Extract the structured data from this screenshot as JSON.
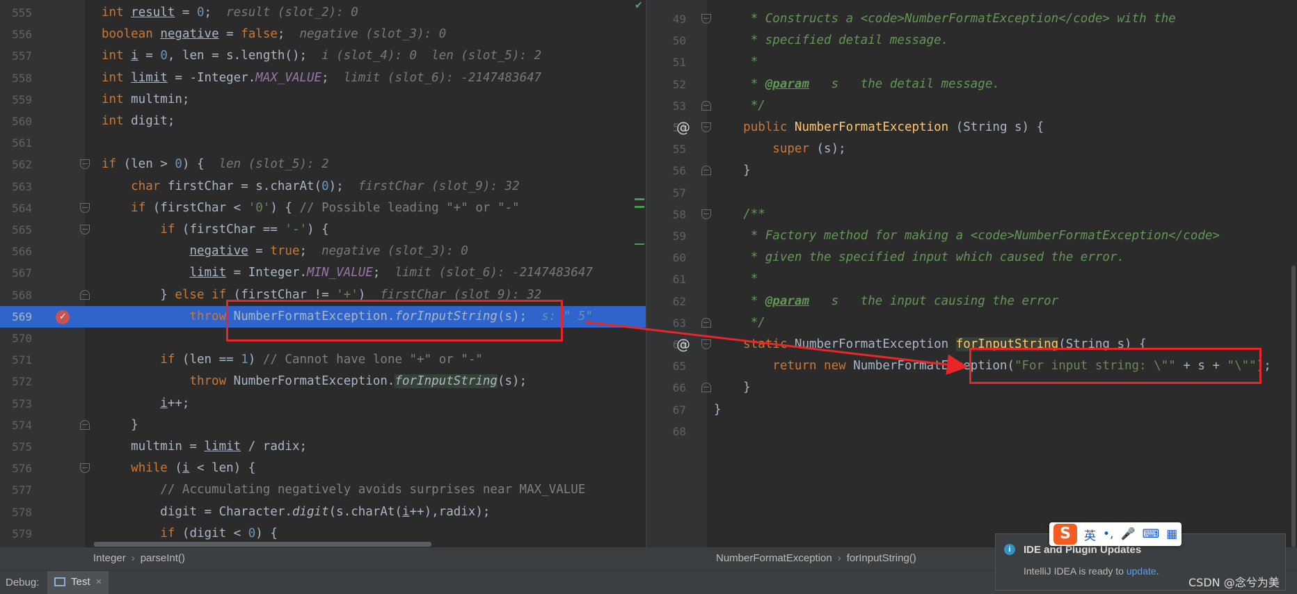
{
  "left_editor": {
    "lines": [
      {
        "n": "555",
        "html": "<span class=\"kw\">int</span> <span class=\"und\">result</span> = <span class=\"num\">0</span>;  <span class=\"hint\">result (slot_2): 0</span>"
      },
      {
        "n": "556",
        "html": "<span class=\"kw\">boolean</span> <span class=\"und\">negative</span> = <span class=\"kw\">false</span>;  <span class=\"hint\">negative (slot_3): 0</span>"
      },
      {
        "n": "557",
        "html": "<span class=\"kw\">int</span> <span class=\"und\">i</span> = <span class=\"num\">0</span>, len = s.length();  <span class=\"hint\">i (slot_4): 0  len (slot_5): 2</span>"
      },
      {
        "n": "558",
        "html": "<span class=\"kw\">int</span> <span class=\"und\">limit</span> = -Integer.<span class=\"italic-c\">MAX_VALUE</span>;  <span class=\"hint\">limit (slot_6): -2147483647</span>"
      },
      {
        "n": "559",
        "html": "<span class=\"kw\">int</span> multmin;"
      },
      {
        "n": "560",
        "html": "<span class=\"kw\">int</span> digit;"
      },
      {
        "n": "561",
        "html": ""
      },
      {
        "n": "562",
        "html": "<span class=\"kw\">if</span> (len &gt; <span class=\"num\">0</span>) {  <span class=\"hint\">len (slot_5): 2</span>"
      },
      {
        "n": "563",
        "html": "    <span class=\"kw\">char</span> firstChar = s.charAt(<span class=\"num\">0</span>);  <span class=\"hint\">firstChar (slot_9): 32</span>"
      },
      {
        "n": "564",
        "html": "    <span class=\"kw\">if</span> (firstChar &lt; <span class=\"str\">'0'</span>) { <span class=\"cm\">// Possible leading \"+\" or \"-\"</span>"
      },
      {
        "n": "565",
        "html": "        <span class=\"kw\">if</span> (firstChar == <span class=\"str\">'-'</span>) {"
      },
      {
        "n": "566",
        "html": "            <span class=\"und\">negative</span> = <span class=\"kw\">true</span>;  <span class=\"hint\">negative (slot_3): 0</span>"
      },
      {
        "n": "567",
        "html": "            <span class=\"und\">limit</span> = Integer.<span class=\"italic-c\">MIN_VALUE</span>;  <span class=\"hint\">limit (slot_6): -2147483647</span>"
      },
      {
        "n": "568",
        "html": "        } <span class=\"kw\">else if</span> (firstChar != <span class=\"str\">'+'</span>)  <span class=\"hint\">firstChar (slot_9): 32</span>"
      },
      {
        "n": "569",
        "html": "            <span class=\"kw\">throw</span> NumberFormatException.<span class=\"m-italic\">forInputString</span>(s);  <span class=\"hint-blue\">s: \" 5\"</span>",
        "current": true
      },
      {
        "n": "570",
        "html": ""
      },
      {
        "n": "571",
        "html": "        <span class=\"kw\">if</span> (len == <span class=\"num\">1</span>) <span class=\"cm\">// Cannot have lone \"+\" or \"-\"</span>"
      },
      {
        "n": "572",
        "html": "            <span class=\"kw\">throw</span> NumberFormatException.<span class=\"m-italic hl-bg\">forInputString</span>(s);"
      },
      {
        "n": "573",
        "html": "        <span class=\"und\">i</span>++;"
      },
      {
        "n": "574",
        "html": "    }"
      },
      {
        "n": "575",
        "html": "    multmin = <span class=\"und\">limit</span> / radix;"
      },
      {
        "n": "576",
        "html": "    <span class=\"kw\">while</span> (<span class=\"und\">i</span> &lt; len) {"
      },
      {
        "n": "577",
        "html": "        <span class=\"cm\">// Accumulating negatively avoids surprises near MAX_VALUE</span>"
      },
      {
        "n": "578",
        "html": "        digit = Character.<span class=\"m-italic\">digit</span>(s.charAt(<span class=\"und\">i</span>++),radix);"
      },
      {
        "n": "579",
        "html": "        <span class=\"kw\">if</span> (digit &lt; <span class=\"num\">0</span>) {"
      }
    ]
  },
  "right_editor": {
    "lines": [
      {
        "n": "49",
        "html": "     <span class=\"doc\">* Constructs a &lt;code&gt;NumberFormatException&lt;/code&gt; with the</span>"
      },
      {
        "n": "50",
        "html": "     <span class=\"doc\">* specified detail message.</span>"
      },
      {
        "n": "51",
        "html": "     <span class=\"doc\">*</span>"
      },
      {
        "n": "52",
        "html": "     <span class=\"doc\">* </span><span class=\"doctag\">@param</span><span class=\"doc\">   s   the detail message.</span>"
      },
      {
        "n": "53",
        "html": "     <span class=\"doc\">*/</span>"
      },
      {
        "n": "54",
        "html": "    <span class=\"kw\">public</span> <span class=\"fn\">NumberFormatException</span> (String s) {",
        "at": true
      },
      {
        "n": "55",
        "html": "        <span class=\"kw\">super</span> (s);"
      },
      {
        "n": "56",
        "html": "    }"
      },
      {
        "n": "57",
        "html": ""
      },
      {
        "n": "58",
        "html": "    <span class=\"doc\">/**</span>"
      },
      {
        "n": "59",
        "html": "     <span class=\"doc\">* Factory method for making a &lt;code&gt;NumberFormatException&lt;/code&gt;</span>"
      },
      {
        "n": "60",
        "html": "     <span class=\"doc\">* given the specified input which caused the error.</span>"
      },
      {
        "n": "61",
        "html": "     <span class=\"doc\">*</span>"
      },
      {
        "n": "62",
        "html": "     <span class=\"doc\">* </span><span class=\"doctag\">@param</span><span class=\"doc\">   s   the input causing the error</span>"
      },
      {
        "n": "63",
        "html": "     <span class=\"doc\">*/</span>"
      },
      {
        "n": "64",
        "html": "    <span class=\"kw\">static</span> NumberFormatException <span class=\"fn hl-bg\">forInputString</span>(String s) {",
        "at": true
      },
      {
        "n": "65",
        "html": "        <span class=\"kw\">return new</span> NumberFormatException(<span class=\"str\">\"For input string: \\\"\"</span> + s + <span class=\"str\">\"\\\"\"</span>);"
      },
      {
        "n": "66",
        "html": "    }"
      },
      {
        "n": "67",
        "html": "}"
      },
      {
        "n": "68",
        "html": ""
      }
    ]
  },
  "status": {
    "left_crumbs": [
      "Integer",
      "parseInt()"
    ],
    "right_crumbs": [
      "NumberFormatException",
      "forInputString()"
    ],
    "separator": "›"
  },
  "debug": {
    "label": "Debug:",
    "tab_label": "Test",
    "tab_close": "×"
  },
  "notification": {
    "title": "IDE and Plugin Updates",
    "body": "IntelliJ IDEA is ready to ",
    "link": "update",
    "suffix": ".",
    "icon": "i"
  },
  "ime": {
    "logo": "S",
    "items": [
      "英",
      "•,",
      "🎤",
      "⌨",
      "▦"
    ]
  },
  "watermark": "CSDN @念兮为美",
  "colors": {
    "current_line": "#2f65ca",
    "annotation_red": "#e8262a",
    "breakpoint": "#c75450"
  }
}
